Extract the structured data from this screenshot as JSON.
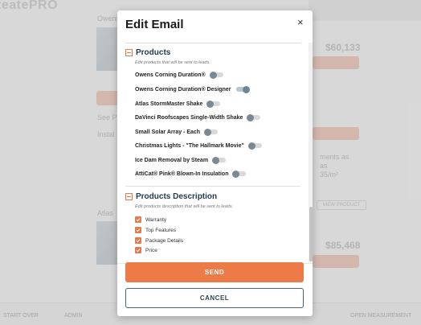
{
  "background": {
    "logo": "teatePRO",
    "price_1": "$60,133",
    "price_2": "$85,468",
    "button_label": "VIEW PRODUCT",
    "snippet_1": "Owens",
    "snippet_2": "See Pr",
    "snippet_3": "Instal",
    "snippet_4": "Atlas",
    "snippet_5": "ments as",
    "snippet_6": "as",
    "snippet_7": "35/m²",
    "bottom_left": "START OVER",
    "bottom_mid": "ADMIN",
    "bottom_right": "OPEN MEASUREMENT"
  },
  "modal": {
    "title": "Edit Email",
    "close_symbol": "×",
    "products": {
      "title": "Products",
      "description": "Edit products that will be sent to leads.",
      "items": [
        {
          "label": "Owens Corning Duration®",
          "enabled": false
        },
        {
          "label": "Owens Corning Duration® Designer",
          "enabled": true
        },
        {
          "label": "Atlas StormMaster Shake",
          "enabled": false
        },
        {
          "label": "DaVinci Roofscapes Single-Width Shake",
          "enabled": false
        },
        {
          "label": "Small Solar Array - Each",
          "enabled": false
        },
        {
          "label": "Christmas Lights - \"The Hallmark Movie\"",
          "enabled": false
        },
        {
          "label": "Ice Dam Removal by Steam",
          "enabled": false
        },
        {
          "label": "AttiCat® Pink® Blown-In Insulation",
          "enabled": false
        }
      ]
    },
    "products_description": {
      "title": "Products Description",
      "description": "Edit products description that will be sent to leads.",
      "items": [
        {
          "label": "Warranty",
          "checked": true
        },
        {
          "label": "Top Features",
          "checked": true
        },
        {
          "label": "Package Details",
          "checked": true
        },
        {
          "label": "Price",
          "checked": true
        }
      ]
    },
    "send_label": "SEND",
    "cancel_label": "CANCEL"
  },
  "colors": {
    "accent": "#ec7b47",
    "heading": "#1f3a4f",
    "toggle_knob": "#7a8a94"
  }
}
